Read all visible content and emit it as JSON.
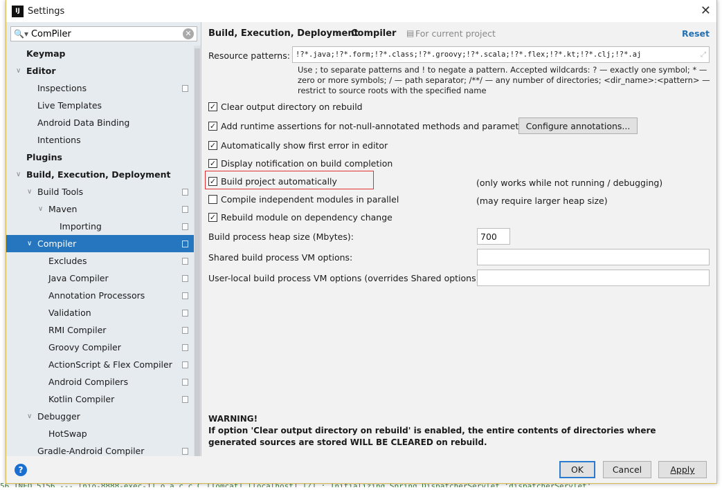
{
  "window": {
    "title": "Settings",
    "icon": "IJ",
    "close": "✕"
  },
  "search": {
    "value": "ComPiler"
  },
  "tree": [
    {
      "label": "Keymap",
      "level": 0,
      "bold": true,
      "arrow": false,
      "copy": false
    },
    {
      "label": "Editor",
      "level": 0,
      "bold": true,
      "arrow": true,
      "copy": false
    },
    {
      "label": "Inspections",
      "level": 1,
      "copy": true
    },
    {
      "label": "Live Templates",
      "level": 1
    },
    {
      "label": "Android Data Binding",
      "level": 1
    },
    {
      "label": "Intentions",
      "level": 1
    },
    {
      "label": "Plugins",
      "level": 0,
      "bold": true
    },
    {
      "label": "Build, Execution, Deployment",
      "level": 0,
      "bold": true,
      "arrow": true
    },
    {
      "label": "Build Tools",
      "level": 1,
      "arrow": true,
      "copy": true
    },
    {
      "label": "Maven",
      "level": 2,
      "arrow": true,
      "copy": true
    },
    {
      "label": "Importing",
      "level": 3,
      "copy": true
    },
    {
      "label": "Compiler",
      "level": 1,
      "arrow": true,
      "copy": true,
      "selected": true
    },
    {
      "label": "Excludes",
      "level": 2,
      "copy": true
    },
    {
      "label": "Java Compiler",
      "level": 2,
      "copy": true
    },
    {
      "label": "Annotation Processors",
      "level": 2,
      "copy": true
    },
    {
      "label": "Validation",
      "level": 2,
      "copy": true
    },
    {
      "label": "RMI Compiler",
      "level": 2,
      "copy": true
    },
    {
      "label": "Groovy Compiler",
      "level": 2,
      "copy": true
    },
    {
      "label": "ActionScript & Flex Compiler",
      "level": 2,
      "copy": true
    },
    {
      "label": "Android Compilers",
      "level": 2,
      "copy": true
    },
    {
      "label": "Kotlin Compiler",
      "level": 2,
      "copy": true
    },
    {
      "label": "Debugger",
      "level": 1,
      "arrow": true
    },
    {
      "label": "HotSwap",
      "level": 2
    },
    {
      "label": "Gradle-Android Compiler",
      "level": 1,
      "copy": true
    }
  ],
  "main": {
    "breadcrumb": [
      "Build, Execution, Deployment",
      "Compiler"
    ],
    "scope": "For current project",
    "reset": "Reset",
    "resource_label": "Resource patterns:",
    "resource_value": "!?*.java;!?*.form;!?*.class;!?*.groovy;!?*.scala;!?*.flex;!?*.kt;!?*.clj;!?*.aj",
    "resource_help": "Use ; to separate patterns and ! to negate a pattern. Accepted wildcards: ? — exactly one symbol; * — zero or more symbols; / — path separator; /**/ — any number of directories; <dir_name>:<pattern> — restrict to source roots with the specified name",
    "checkboxes": [
      {
        "label": "Clear output directory on rebuild",
        "checked": true
      },
      {
        "label": "Add runtime assertions for not-null-annotated methods and parameters",
        "checked": true
      },
      {
        "label": "Automatically show first error in editor",
        "checked": true
      },
      {
        "label": "Display notification on build completion",
        "checked": true
      },
      {
        "label": "Build project automatically",
        "checked": true,
        "note": "(only works while not running / debugging)"
      },
      {
        "label": "Compile independent modules in parallel",
        "checked": false,
        "note": "(may require larger heap size)"
      },
      {
        "label": "Rebuild module on dependency change",
        "checked": true
      }
    ],
    "configure_button": "Configure annotations...",
    "heap_label": "Build process heap size (Mbytes):",
    "heap_value": "700",
    "shared_label": "Shared build process VM options:",
    "shared_value": "",
    "user_label": "User-local build process VM options (overrides Shared options):",
    "user_value": "",
    "warning_title": "WARNING!",
    "warning_text": "If option 'Clear output directory on rebuild' is enabled, the entire contents of directories where generated sources are stored WILL BE CLEARED on rebuild."
  },
  "footer": {
    "ok": "OK",
    "cancel": "Cancel",
    "apply": "Apply",
    "help": "?"
  },
  "background_log": "56  INFO 5156 --- [nio-8888-exec-1] o.a.c.c.C.[Tomcat].[localhost].[/]       : Initializing Spring DispatcherServlet 'dispatcherServlet'"
}
